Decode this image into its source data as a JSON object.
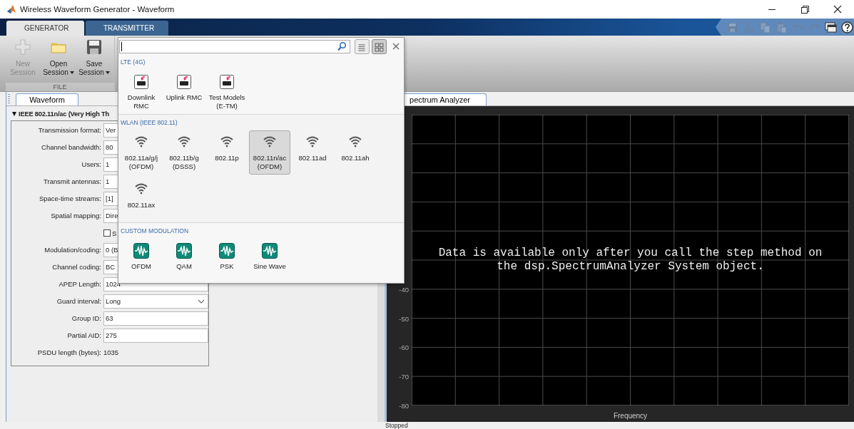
{
  "window": {
    "title": "Wireless Waveform Generator - Waveform"
  },
  "ribbon": {
    "tabs": [
      {
        "label": "GENERATOR",
        "selected": true
      },
      {
        "label": "TRANSMITTER",
        "selected": false
      }
    ],
    "quick_access": [
      {
        "kind": "save",
        "disabled": true
      },
      {
        "kind": "cut",
        "disabled": true
      },
      {
        "kind": "copy",
        "disabled": true
      },
      {
        "kind": "paste",
        "disabled": true
      },
      {
        "kind": "undo",
        "disabled": true
      },
      {
        "kind": "redo",
        "disabled": true
      },
      {
        "kind": "layout",
        "disabled": false
      },
      {
        "kind": "help",
        "disabled": false
      }
    ],
    "buttons": [
      {
        "kind": "new",
        "label": "New Session",
        "disabled": true,
        "menu": false
      },
      {
        "kind": "open",
        "label": "Open Session",
        "disabled": false,
        "menu": true
      },
      {
        "kind": "save",
        "label": "Save Session",
        "disabled": false,
        "menu": true
      }
    ],
    "group": "FILE"
  },
  "left_panel": {
    "tab": {
      "label": "Waveform",
      "selected": true
    },
    "section": {
      "title": "IEEE 802.11n/ac (Very High Th",
      "expanded": true
    },
    "fields": [
      {
        "kind": "text",
        "label": "Transmission format:",
        "value": "Ver"
      },
      {
        "kind": "text",
        "label": "Channel bandwidth:",
        "value": "80"
      },
      {
        "kind": "text",
        "label": "Users:",
        "value": "1"
      },
      {
        "kind": "text",
        "label": "Transmit antennas:",
        "value": "1"
      },
      {
        "kind": "text",
        "label": "Space-time streams:",
        "value": "[1]"
      },
      {
        "kind": "text",
        "label": "Spatial mapping:",
        "value": "Dire"
      },
      {
        "kind": "checkbox",
        "label": "S",
        "checked": false
      },
      {
        "kind": "text",
        "label": "Modulation/coding:",
        "value": "0 (B"
      },
      {
        "kind": "text",
        "label": "Channel coding:",
        "value": "BC"
      },
      {
        "kind": "text",
        "label": "APEP Length:",
        "value": "1024"
      },
      {
        "kind": "dropdown",
        "label": "Guard interval:",
        "value": "Long"
      },
      {
        "kind": "text",
        "label": "Group ID:",
        "value": "63"
      },
      {
        "kind": "text",
        "label": "Partial AID:",
        "value": "275"
      },
      {
        "kind": "readout",
        "label": "PSDU length (bytes):",
        "value": "1035"
      }
    ]
  },
  "scope": {
    "tab": {
      "label": "pectrum Analyzer",
      "selected": true
    },
    "y_tick_labels": [
      "-40",
      "-50",
      "-60",
      "-70",
      "-80"
    ],
    "xlabel": "Frequency",
    "message": "Data is available only after you call the step method on the dsp.SpectrumAnalyzer System object."
  },
  "status_bar": {
    "text": "Stopped"
  },
  "gallery": {
    "views": [
      {
        "kind": "list",
        "selected": false
      },
      {
        "kind": "grid",
        "selected": true
      }
    ],
    "sections": [
      {
        "title": "LTE (4G)",
        "items": [
          {
            "kind": "lte",
            "label": "Downlink RMC",
            "selected": false
          },
          {
            "kind": "lte",
            "label": "Uplink RMC",
            "selected": false
          },
          {
            "kind": "lte",
            "label": "Test Models (E-TM)",
            "selected": false
          }
        ]
      },
      {
        "title": "WLAN (IEEE 802.11)",
        "items": [
          {
            "kind": "wlan",
            "label": "802.11a/g/j (OFDM)",
            "selected": false
          },
          {
            "kind": "wlan",
            "label": "802.11b/g (DSSS)",
            "selected": false
          },
          {
            "kind": "wlan",
            "label": "802.11p",
            "selected": false
          },
          {
            "kind": "wlan",
            "label": "802.11n/ac (OFDM)",
            "selected": true
          },
          {
            "kind": "wlan",
            "label": "802.11ad",
            "selected": false
          },
          {
            "kind": "wlan",
            "label": "802.11ah",
            "selected": false
          },
          {
            "kind": "wlan",
            "label": "802.11ax",
            "selected": false
          }
        ]
      },
      {
        "title": "CUSTOM MODULATION",
        "items": [
          {
            "kind": "custom",
            "label": "OFDM",
            "selected": false
          },
          {
            "kind": "custom",
            "label": "QAM",
            "selected": false
          },
          {
            "kind": "custom",
            "label": "PSK",
            "selected": false
          },
          {
            "kind": "custom",
            "label": "Sine Wave",
            "selected": false
          }
        ]
      }
    ]
  }
}
